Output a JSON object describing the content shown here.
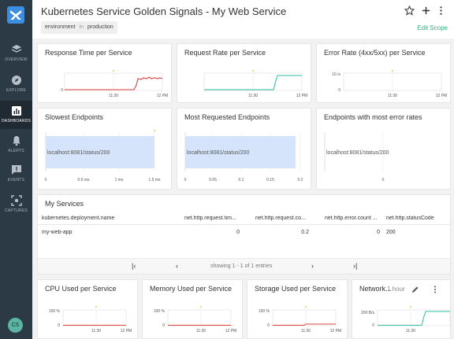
{
  "sidebar": {
    "items": [
      {
        "label": "OVERVIEW",
        "icon": "layers-icon"
      },
      {
        "label": "EXPLORE",
        "icon": "compass-icon"
      },
      {
        "label": "DASHBOARDS",
        "icon": "bar-chart-icon",
        "active": true
      },
      {
        "label": "ALERTS",
        "icon": "bell-icon"
      },
      {
        "label": "EVENTS",
        "icon": "message-alert-icon"
      },
      {
        "label": "CAPTURES",
        "icon": "capture-icon"
      }
    ],
    "avatar_initials": "CS"
  },
  "header": {
    "title": "Kubernetes Service Golden Signals - My Web Service",
    "scope": {
      "key": "environment",
      "op": "in",
      "value": "production"
    },
    "edit_scope": "Edit Scope"
  },
  "panels": {
    "response_time": {
      "title": "Response Time per Service",
      "x_ticks": [
        "11:30",
        "12 PM"
      ]
    },
    "request_rate": {
      "title": "Request Rate per Service",
      "x_ticks": [
        "11:30",
        "12 PM"
      ]
    },
    "error_rate": {
      "title": "Error Rate (4xx/5xx) per Service",
      "y_tick": "10 /s",
      "y_zero": "0",
      "x_ticks": [
        "11:30",
        "12 PM"
      ]
    },
    "slowest": {
      "title": "Slowest Endpoints",
      "bar_label": "localhost:8081/status/200",
      "x_ticks": [
        "0",
        "0.5 ms",
        "1 ms",
        "1.5 ms"
      ]
    },
    "most_requested": {
      "title": "Most Requested Endpoints",
      "bar_label": "localhost:8081/status/200",
      "x_ticks": [
        "0",
        "0.05",
        "0.1",
        "0.15",
        "0.2"
      ]
    },
    "most_errors": {
      "title": "Endpoints with most error rates",
      "bar_label": "localhost:8081/status/200",
      "x_ticks": [
        "0"
      ]
    },
    "services": {
      "title": "My Services",
      "columns": [
        "kubernetes.deployment.name",
        "net.http.request.tim...",
        "net.http.request.co...",
        "net.http.error.count ...",
        "net.http.statusCode"
      ],
      "rows": [
        [
          "my-web-app",
          "0",
          "0.2",
          "0",
          "200"
        ]
      ],
      "pager_text": "showing 1 - 1 of 1 entries"
    },
    "cpu": {
      "title": "CPU Used per Service",
      "y_tick": "100 %",
      "y_zero": "0",
      "x_ticks": [
        "11:30",
        "12 PM"
      ]
    },
    "memory": {
      "title": "Memory Used per Service",
      "y_tick": "100 %",
      "y_zero": "0",
      "x_ticks": [
        "11:30",
        "12 PM"
      ]
    },
    "storage": {
      "title": "Storage Used per Service",
      "y_tick": "100 %",
      "y_zero": "0",
      "x_ticks": [
        "11:30",
        "12 PM"
      ]
    },
    "network": {
      "title": "Network...",
      "time_range": "1 hour",
      "y_tick": "200 B/s",
      "y_zero": "0",
      "x_ticks": [
        "11:30"
      ]
    }
  },
  "colors": {
    "accent": "#2fae7c",
    "red_series": "#e2403f",
    "teal_series": "#2bbfa4",
    "bar_fill": "#d6e4fb",
    "marker": "#f0b429"
  }
}
